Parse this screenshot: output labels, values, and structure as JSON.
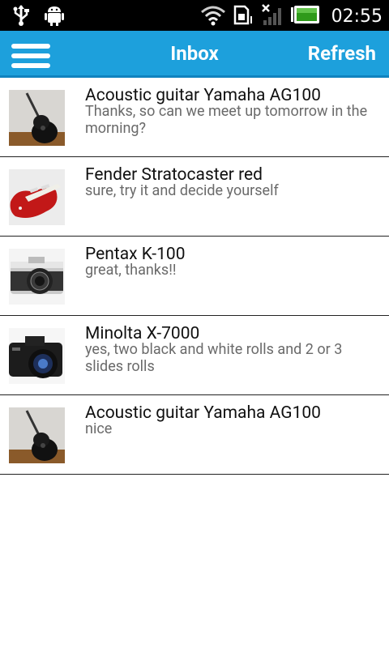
{
  "status_bar": {
    "time": "02:55",
    "icons": [
      "usb-icon",
      "android-debug-icon",
      "wifi-icon",
      "sdcard-icon",
      "no-signal-icon",
      "battery-icon"
    ]
  },
  "action_bar": {
    "menu_icon": "hamburger-menu-icon",
    "title": "Inbox",
    "refresh_label": "Refresh",
    "color": "#1da0dc"
  },
  "inbox": {
    "items": [
      {
        "title": "Acoustic guitar Yamaha AG100",
        "message": "Thanks, so can we meet up tomorrow in the morning?",
        "thumbnail": "acoustic-guitar"
      },
      {
        "title": "Fender Stratocaster red",
        "message": "sure, try it and decide yourself",
        "thumbnail": "electric-guitar-red"
      },
      {
        "title": "Pentax K-100",
        "message": "great, thanks!!",
        "thumbnail": "film-camera-silver"
      },
      {
        "title": "Minolta X-7000",
        "message": "yes, two black and white rolls and 2 or 3 slides rolls",
        "thumbnail": "film-camera-black"
      },
      {
        "title": "Acoustic guitar Yamaha AG100",
        "message": "nice",
        "thumbnail": "acoustic-guitar"
      }
    ]
  }
}
